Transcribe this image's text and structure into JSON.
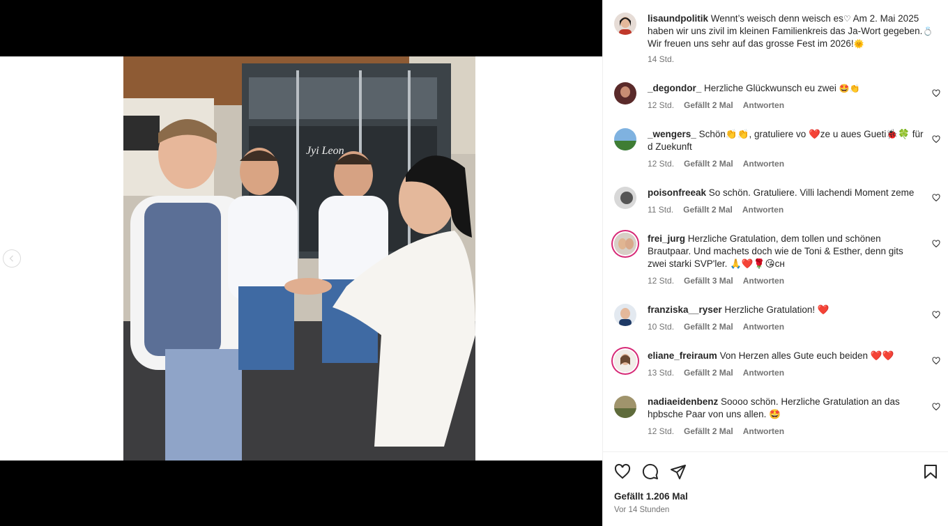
{
  "post": {
    "username": "lisaundpolitik",
    "caption_part1": "Wennt’s weisch denn weisch es",
    "caption_part2": " Am 2. Mai 2025 haben wir uns zivil im kleinen Familienkreis das Ja-Wort gegeben.",
    "caption_part3": "Wir freuen uns sehr auf das grosse Fest im 2026!",
    "time": "14 Std.",
    "likes": "Gefällt 1.206 Mal",
    "posted": "Vor 14 Stunden"
  },
  "photo": {
    "sign_text": "Jyi Leon",
    "carousel_count": 4,
    "carousel_active": 4
  },
  "labels": {
    "reply": "Antworten"
  },
  "comments": [
    {
      "user": "_degondor_",
      "text": "Herzliche Glückwunsch eu zwei",
      "emoji": "🤩👏",
      "time": "12 Std.",
      "likes": "Gefällt 2 Mal"
    },
    {
      "user": "_wengers_",
      "text": "Schön👏👏, gratuliere vo ❤️ze u aues Gueti🐞🍀 für d Zuekunft",
      "emoji": "",
      "time": "12 Std.",
      "likes": "Gefällt 2 Mal"
    },
    {
      "user": "poisonfreeak",
      "text": "So schön. Gratuliere. Villi lachendi Moment zeme",
      "emoji": "",
      "time": "11 Std.",
      "likes": "Gefällt 2 Mal"
    },
    {
      "user": "frei_jurg",
      "text": "Herzliche Gratulation, dem tollen und schönen Brautpaar. Und machets doch wie de Toni & Esther, denn gits zwei starki SVP'ler. 🙏❤️🌹😘ᴄʜ",
      "emoji": "",
      "time": "12 Std.",
      "likes": "Gefällt 3 Mal"
    },
    {
      "user": "franziska__ryser",
      "text": "Herzliche Gratulation! ❤️",
      "emoji": "",
      "time": "10 Std.",
      "likes": "Gefällt 2 Mal"
    },
    {
      "user": "eliane_freiraum",
      "text": "Von Herzen alles Gute euch beiden ❤️❤️",
      "emoji": "",
      "time": "13 Std.",
      "likes": "Gefällt 2 Mal"
    },
    {
      "user": "nadiaeidenbenz",
      "text": "Soooo schön. Herzliche Gratulation an das hpbsche Paar von uns allen. 🤩",
      "emoji": "",
      "time": "12 Std.",
      "likes": "Gefällt 2 Mal"
    }
  ],
  "colors": {
    "meta_gray": "#737373",
    "story_ring": "#d62976"
  }
}
